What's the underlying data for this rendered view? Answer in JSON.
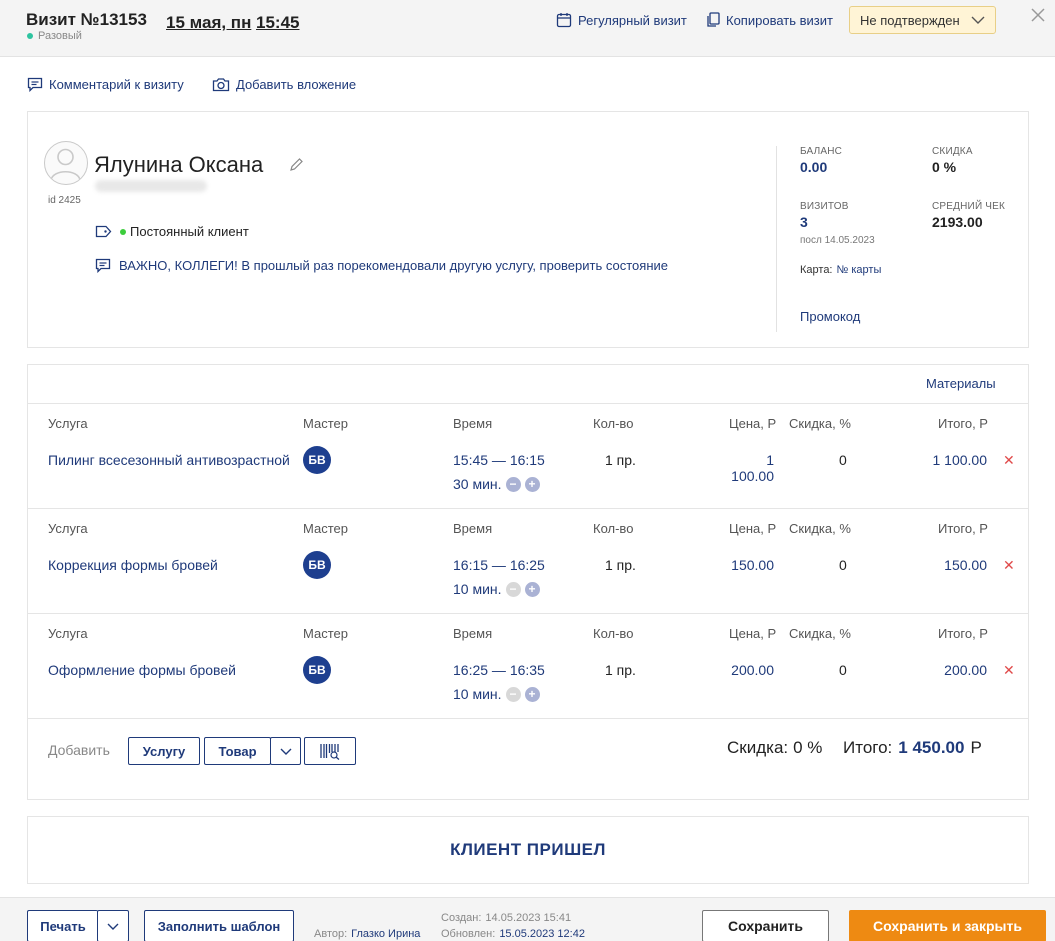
{
  "header": {
    "title": "Визит №13153",
    "visit_type": "Разовый",
    "date": "15 мая, пн",
    "time": "15:45",
    "recurring_label": "Регулярный визит",
    "copy_label": "Копировать визит",
    "status": "Не подтвержден"
  },
  "actions": {
    "comment_label": "Комментарий к визиту",
    "attach_label": "Добавить вложение"
  },
  "client": {
    "name": "Ялунина Оксана",
    "id": "id 2425",
    "tag": "Постоянный клиент",
    "note": "ВАЖНО, КОЛЛЕГИ! В прошлый раз порекомендовали другую услугу, проверить состояние",
    "stats": {
      "balance_label": "БАЛАНС",
      "balance": "0.00",
      "discount_label": "СКИДКА",
      "discount": "0 %",
      "visits_label": "ВИЗИТОВ",
      "visits": "3",
      "last_visit": "посл 14.05.2023",
      "avg_label": "СРЕДНИЙ ЧЕК",
      "avg": "2193.00",
      "card_label": "Карта:",
      "card_link": "№ карты",
      "promo": "Промокод"
    }
  },
  "services_panel": {
    "materials": "Материалы",
    "columns": {
      "service": "Услуга",
      "master": "Мастер",
      "time": "Время",
      "qty": "Кол-во",
      "price": "Цена, Р",
      "discount": "Скидка, %",
      "total": "Итого, Р"
    },
    "rows": [
      {
        "name": "Пилинг всесезонный антивозрастной",
        "master": "БВ",
        "time_range": "15:45 — 16:15",
        "duration": "30 мин.",
        "qty": "1 пр.",
        "price": "1 100.00",
        "discount": "0",
        "total": "1 100.00"
      },
      {
        "name": "Коррекция формы бровей",
        "master": "БВ",
        "time_range": "16:15 — 16:25",
        "duration": "10 мин.",
        "qty": "1 пр.",
        "price": "150.00",
        "discount": "0",
        "total": "150.00"
      },
      {
        "name": "Оформление формы бровей",
        "master": "БВ",
        "time_range": "16:25 — 16:35",
        "duration": "10 мин.",
        "qty": "1 пр.",
        "price": "200.00",
        "discount": "0",
        "total": "200.00"
      }
    ],
    "add_label": "Добавить",
    "add_service": "Услугу",
    "add_product": "Товар",
    "discount_total_label": "Скидка:",
    "discount_total": "0 %",
    "total_label": "Итого:",
    "total_value": "1 450.00",
    "currency": "Р"
  },
  "client_arrived": "КЛИЕНТ ПРИШЕЛ",
  "footer": {
    "print": "Печать",
    "template": "Заполнить шаблон",
    "author_label": "Автор:",
    "author": "Глазко Ирина",
    "created_label": "Создан:",
    "created": "14.05.2023 15:41",
    "updated_label": "Обновлен:",
    "updated": "15.05.2023 12:42",
    "save": "Сохранить",
    "save_close": "Сохранить и закрыть"
  },
  "colors": {
    "accent": "#1f3a7a",
    "status_bg": "#fff4d6",
    "save_close_bg": "#ee8a12",
    "delete": "#e04a4a",
    "badge": "#1e3f8f"
  }
}
